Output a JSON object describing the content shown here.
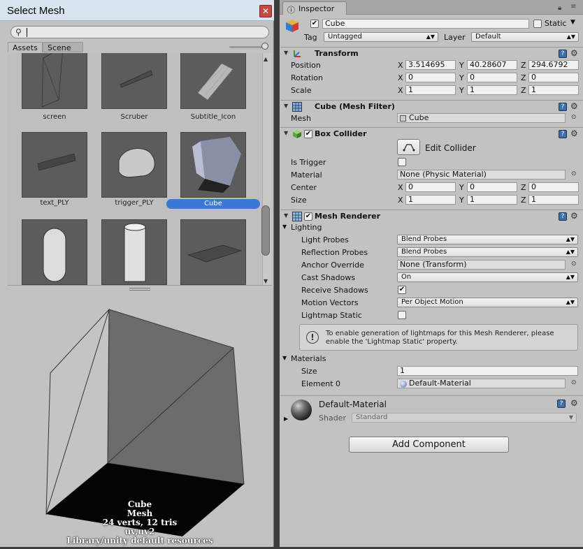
{
  "select_mesh": {
    "title": "Select Mesh",
    "close": "✕",
    "search_placeholder": "",
    "tabs": [
      "Assets",
      "Scene"
    ],
    "items": [
      {
        "label": "screen"
      },
      {
        "label": "Scruber"
      },
      {
        "label": "Subtitle_Icon"
      },
      {
        "label": "text_PLY"
      },
      {
        "label": "trigger_PLY"
      },
      {
        "label": "Cube",
        "selected": true
      },
      {
        "label": ""
      },
      {
        "label": ""
      },
      {
        "label": ""
      }
    ],
    "preview_info": {
      "name": "Cube",
      "type": "Mesh",
      "stats": "24 verts, 12 tris",
      "channels": "uv,uv2",
      "source": "Library/unity default resources"
    }
  },
  "inspector": {
    "tab_label": "Inspector",
    "object": {
      "name": "Cube",
      "active": true,
      "static_label": "Static",
      "tag_label": "Tag",
      "tag_value": "Untagged",
      "layer_label": "Layer",
      "layer_value": "Default"
    },
    "transform": {
      "title": "Transform",
      "rows": [
        {
          "label": "Position",
          "x": "3.514695",
          "y": "40.28607",
          "z": "294.6792"
        },
        {
          "label": "Rotation",
          "x": "0",
          "y": "0",
          "z": "0"
        },
        {
          "label": "Scale",
          "x": "1",
          "y": "1",
          "z": "1"
        }
      ]
    },
    "mesh_filter": {
      "title": "Cube (Mesh Filter)",
      "mesh_label": "Mesh",
      "mesh_value": "Cube"
    },
    "box_collider": {
      "title": "Box Collider",
      "enabled": true,
      "edit_label": "Edit Collider",
      "is_trigger_label": "Is Trigger",
      "is_trigger": false,
      "material_label": "Material",
      "material_value": "None (Physic Material)",
      "center_label": "Center",
      "center": {
        "x": "0",
        "y": "0",
        "z": "0"
      },
      "size_label": "Size",
      "size": {
        "x": "1",
        "y": "1",
        "z": "1"
      }
    },
    "mesh_renderer": {
      "title": "Mesh Renderer",
      "enabled": true,
      "lighting_label": "Lighting",
      "light_probes_label": "Light Probes",
      "light_probes_value": "Blend Probes",
      "reflection_probes_label": "Reflection Probes",
      "reflection_probes_value": "Blend Probes",
      "anchor_override_label": "Anchor Override",
      "anchor_override_value": "None (Transform)",
      "cast_shadows_label": "Cast Shadows",
      "cast_shadows_value": "On",
      "receive_shadows_label": "Receive Shadows",
      "receive_shadows": true,
      "motion_vectors_label": "Motion Vectors",
      "motion_vectors_value": "Per Object Motion",
      "lightmap_static_label": "Lightmap Static",
      "lightmap_static": false,
      "info_line1": "To enable generation of lightmaps for this Mesh Renderer, please",
      "info_line2": "enable the 'Lightmap Static' property.",
      "materials_label": "Materials",
      "size_label": "Size",
      "size_value": "1",
      "element0_label": "Element 0",
      "element0_value": "Default-Material"
    },
    "material": {
      "name": "Default-Material",
      "shader_label": "Shader",
      "shader_value": "Standard"
    },
    "add_component_label": "Add Component"
  }
}
